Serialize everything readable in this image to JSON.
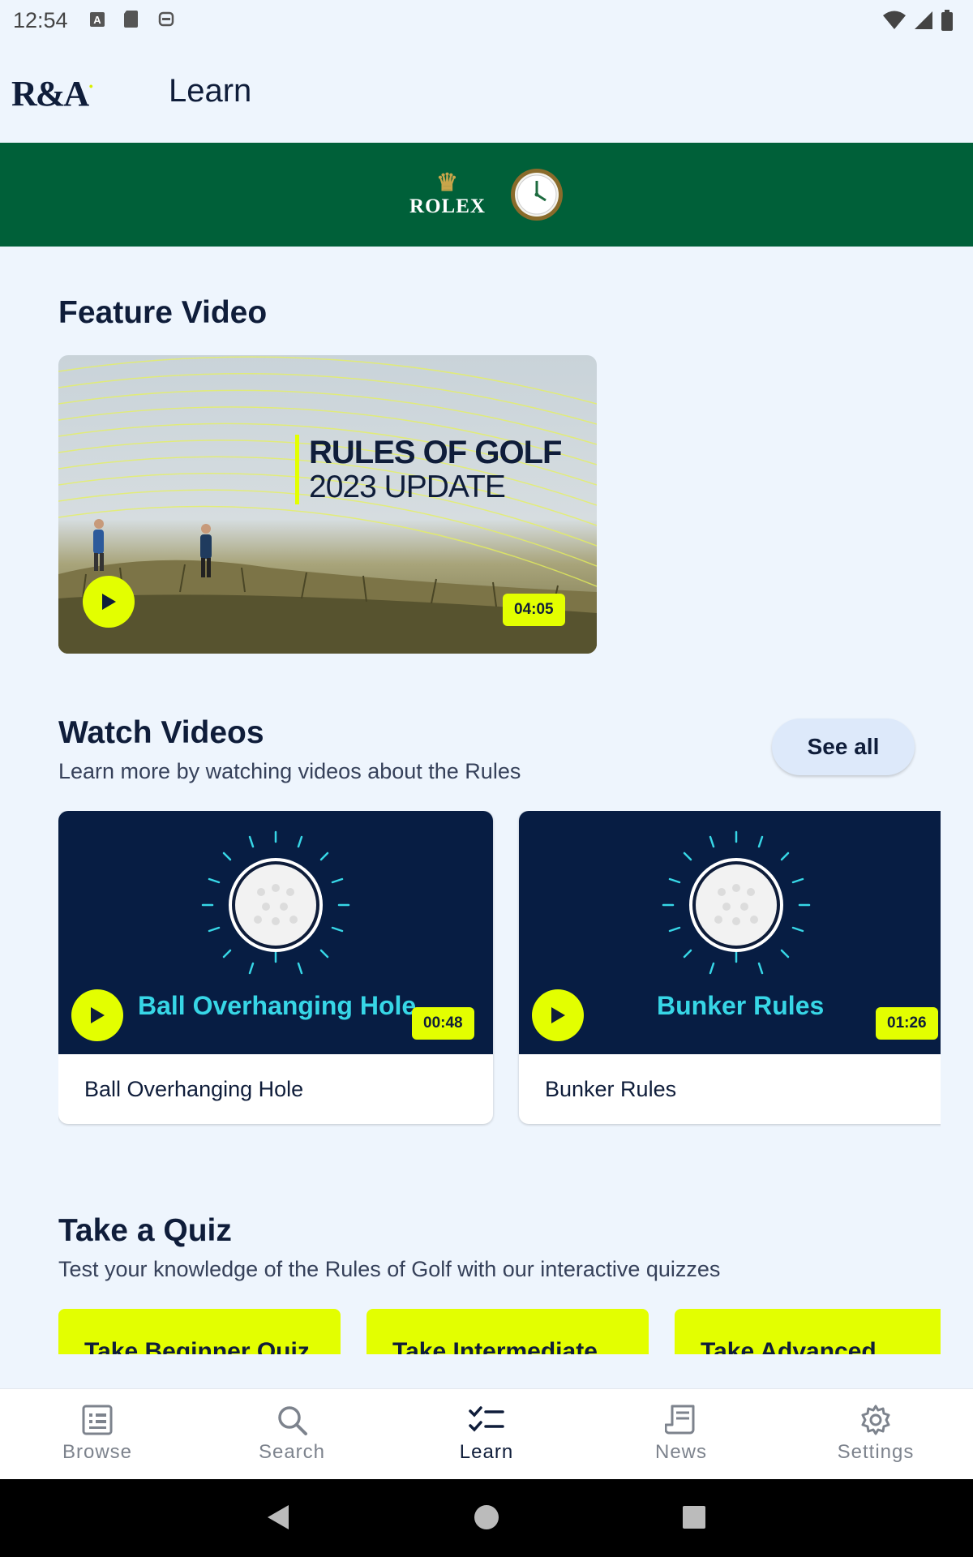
{
  "status_bar": {
    "time": "12:54"
  },
  "header": {
    "logo": "R&A",
    "title": "Learn"
  },
  "sponsor": {
    "name": "ROLEX",
    "brand_color": "#006039"
  },
  "feature": {
    "section_title": "Feature Video",
    "headline_line1": "RULES OF GOLF",
    "headline_line2": "2023 UPDATE",
    "duration": "04:05"
  },
  "watch": {
    "section_title": "Watch Videos",
    "subtitle": "Learn more by watching videos about the Rules",
    "see_all_label": "See all",
    "videos": [
      {
        "thumb_title": "Ball Overhanging Hole",
        "duration": "00:48",
        "caption": "Ball Overhanging Hole"
      },
      {
        "thumb_title": "Bunker Rules",
        "duration": "01:26",
        "caption": "Bunker Rules"
      }
    ]
  },
  "quiz": {
    "section_title": "Take a Quiz",
    "subtitle": "Test your knowledge of the Rules of Golf with our interactive quizzes",
    "cards": [
      {
        "label": "Take Beginner Quiz"
      },
      {
        "label": "Take Intermediate"
      },
      {
        "label": "Take Advanced"
      }
    ]
  },
  "nav": {
    "items": [
      {
        "label": "Browse",
        "icon": "browse-icon"
      },
      {
        "label": "Search",
        "icon": "search-icon"
      },
      {
        "label": "Learn",
        "icon": "learn-icon",
        "active": true
      },
      {
        "label": "News",
        "icon": "news-icon"
      },
      {
        "label": "Settings",
        "icon": "settings-icon"
      }
    ]
  },
  "colors": {
    "accent": "#e3ff00",
    "navy": "#0f1d3a",
    "thumb_bg": "#071d43",
    "thumb_text": "#37d6e6"
  }
}
